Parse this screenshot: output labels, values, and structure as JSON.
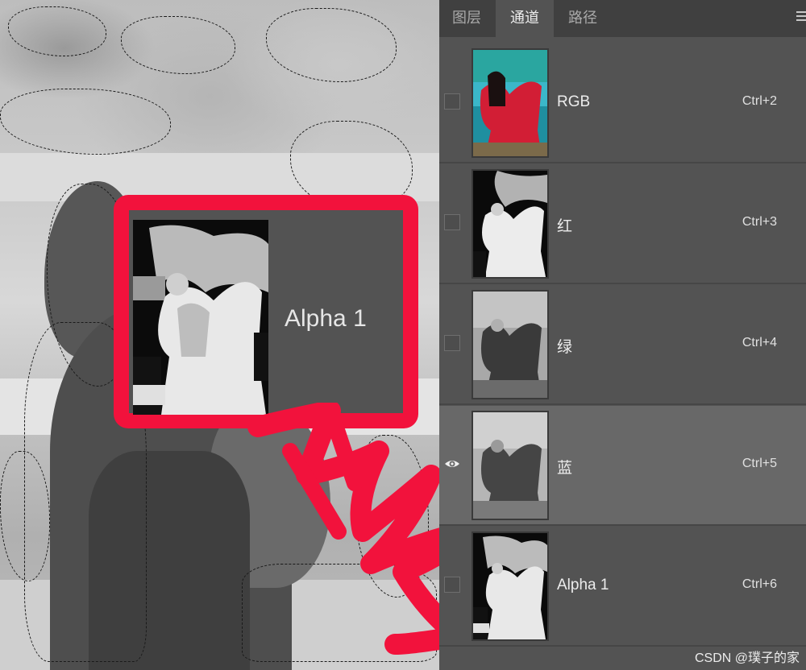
{
  "canvas": {
    "callout": {
      "label": "Alpha 1"
    }
  },
  "panel": {
    "tabs": [
      {
        "label": "图层"
      },
      {
        "label": "通道"
      },
      {
        "label": "路径"
      }
    ],
    "active_tab": "通道",
    "channels": [
      {
        "name": "RGB",
        "shortcut": "Ctrl+2",
        "visible": false,
        "selected": false
      },
      {
        "name": "红",
        "shortcut": "Ctrl+3",
        "visible": false,
        "selected": false
      },
      {
        "name": "绿",
        "shortcut": "Ctrl+4",
        "visible": false,
        "selected": false
      },
      {
        "name": "蓝",
        "shortcut": "Ctrl+5",
        "visible": true,
        "selected": true
      },
      {
        "name": "Alpha 1",
        "shortcut": "Ctrl+6",
        "visible": false,
        "selected": false
      }
    ]
  },
  "watermark": "CSDN @璞子的家",
  "colors": {
    "callout_border": "#f2123c",
    "panel_bg": "#535353",
    "selected_row": "#686868"
  },
  "icons": {
    "visibility": "eye-icon",
    "panel_menu": "hamburger-menu-icon"
  }
}
